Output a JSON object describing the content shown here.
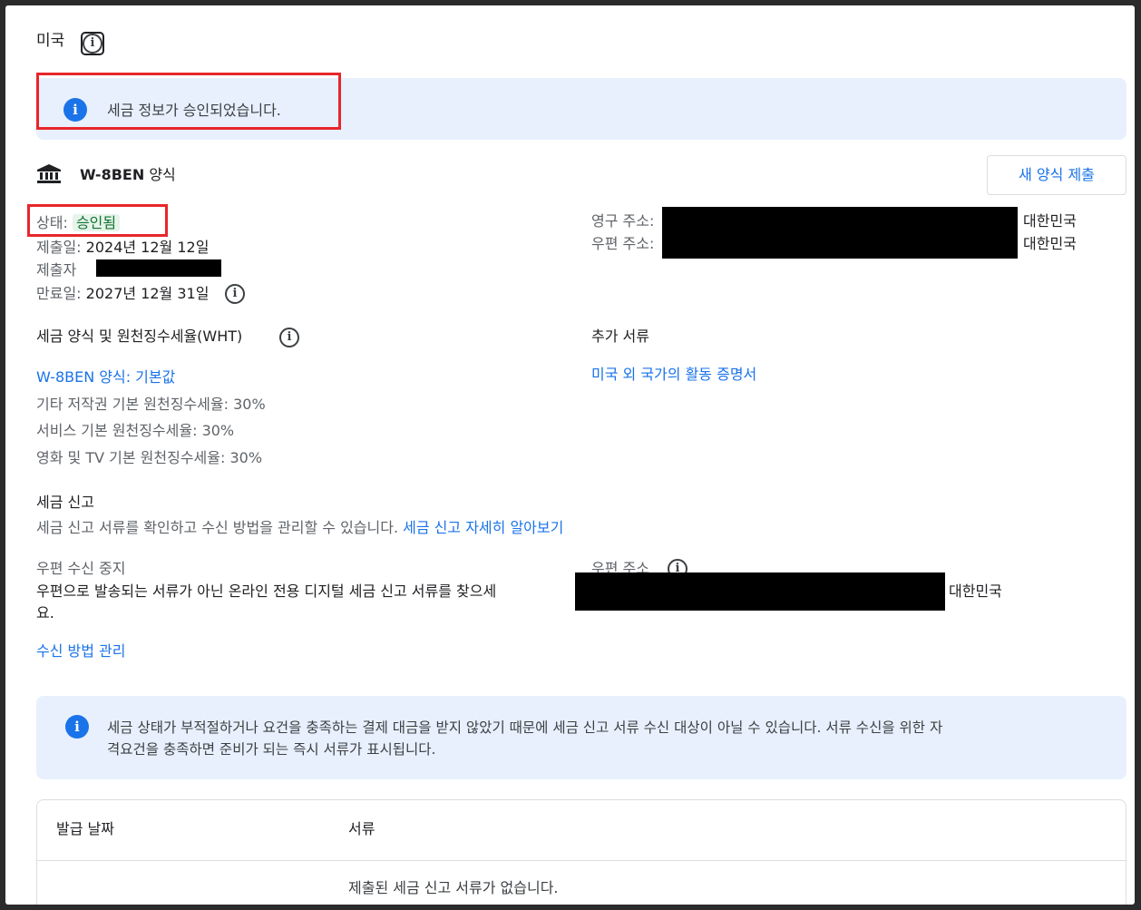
{
  "country": {
    "name": "미국"
  },
  "approval_banner": {
    "message": "세금 정보가 승인되었습니다."
  },
  "form": {
    "title": "W-8BEN",
    "title_suffix": "양식",
    "new_form_button": "새 양식 제출",
    "status_label": "상태:",
    "status_value": "승인됨",
    "submitted_label": "제출일:",
    "submitted_value": "2024년 12월 12일",
    "submitter_label": "제출자",
    "expiry_label": "만료일:",
    "expiry_value": "2027년 12월 31일",
    "permanent_address_label": "영구 주소:",
    "permanent_address_country": "대한민국",
    "mailing_address_label": "우편 주소:",
    "mailing_address_country": "대한민국"
  },
  "wht": {
    "heading": "세금 양식 및 원천징수세율(WHT)",
    "form_link": "W-8BEN 양식: 기본값",
    "rates": [
      "기타 저작권 기본 원천징수세율: 30%",
      "서비스 기본 원천징수세율: 30%",
      "영화 및 TV 기본 원천징수세율: 30%"
    ]
  },
  "additional_docs": {
    "heading": "추가 서류",
    "link": "미국 외 국가의 활동 증명서"
  },
  "tax_reporting": {
    "heading": "세금 신고",
    "description": "세금 신고 서류를 확인하고 수신 방법을 관리할 수 있습니다.",
    "learn_more": "세금 신고 자세히 알아보기",
    "paper_stop_label": "우편 수신 중지",
    "paper_stop_text_1": "우편으로 발송되는 서류가 아닌 온라인 전용 디지털 세금 신고 서류를 찾으세",
    "paper_stop_text_2": "요.",
    "mail_address_label": "우편 주소",
    "mail_address_country": "대한민국",
    "manage_link": "수신 방법 관리"
  },
  "eligibility_banner": {
    "line1": "세금 상태가 부적절하거나 요건을 충족하는 결제 대금을 받지 않았기 때문에 세금 신고 서류 수신 대상이 아닐 수 있습니다. 서류 수신을 위한 자",
    "line2": "격요건을 충족하면 준비가 되는 즉시 서류가 표시됩니다."
  },
  "documents_table": {
    "columns": [
      "발급 날짜",
      "서류"
    ],
    "empty_message": "제출된 세금 신고 서류가 없습니다."
  },
  "colors": {
    "link": "#1a73e8",
    "banner_bg": "#e8f0fe",
    "highlight_red": "#e8262b",
    "status_green": "#137333"
  }
}
